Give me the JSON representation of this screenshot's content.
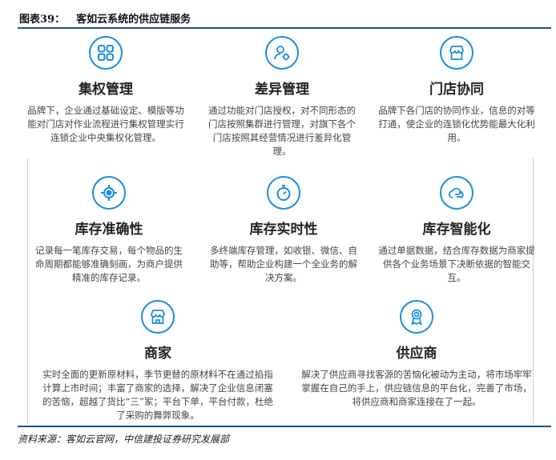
{
  "header": {
    "figure_number": "图表39：",
    "title": "客如云系统的供应链服务"
  },
  "features": [
    {
      "title": "集权管理",
      "icon": "grid-icon",
      "desc": "品牌下，企业通过基础设定、模版等功能对门店对作业流程进行集权管理实行连锁企业中央集权化管理。"
    },
    {
      "title": "差异管理",
      "icon": "user-settings-icon",
      "desc": "通过功能对门店授权，对不同形态的门店按照集群进行管理，对旗下各个门店按照其经营情况进行差异化管理。"
    },
    {
      "title": "门店协同",
      "icon": "storefront-icon",
      "desc": "品牌下各门店的协同作业，信息的对等打通，使企业的连锁化优势能最大化利用。"
    },
    {
      "title": "库存准确性",
      "icon": "target-icon",
      "desc": "记录每一笔库存交易，每个物品的生命周期都能够准确刻画，为商户提供精准的库存记录。"
    },
    {
      "title": "库存实时性",
      "icon": "stopwatch-icon",
      "desc": "多终端库存管理，如收银、微信、自助等，帮助企业构建一个全业务的解决方案。"
    },
    {
      "title": "库存智能化",
      "icon": "cloud-circuit-icon",
      "desc": "通过单据数据，结合库存数据为商家提供各个业务场景下决断依据的智能交互。"
    },
    {
      "title": "商家",
      "icon": "shop-icon",
      "desc": "实时全面的更新原材料，季节更替的原材料不在通过掐指计算上市时间；丰富了商家的选择，解决了企业信息闭塞的苦恼，超越了货比“三”家；平台下单，平台付款，杜绝了采购的舞弊现象。"
    },
    {
      "title": "供应商",
      "icon": "award-icon",
      "desc": "解决了供应商寻找客源的苦恼化被动为主动，将市场牢牢掌握在自己的手上，供应链信息的平台化，完善了市场，将供应商和商家连接在了一起。"
    }
  ],
  "footer": {
    "source": "资料来源：客如云官网，中信建投证券研究发展部"
  },
  "colors": {
    "accent": "#1a8fe0",
    "rule": "#1f4e8c"
  }
}
